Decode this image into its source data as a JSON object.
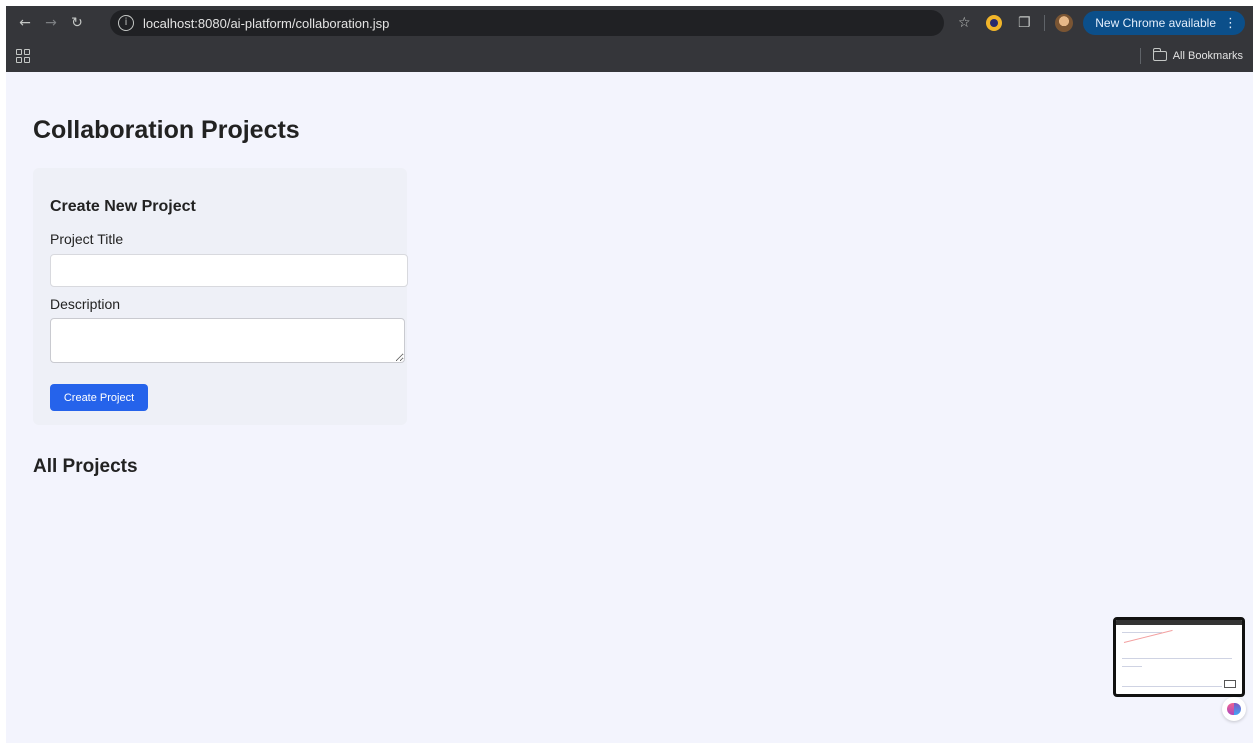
{
  "browser": {
    "url": "localhost:8080/ai-platform/collaboration.jsp",
    "update_label": "New Chrome available",
    "bookmarks_label": "All Bookmarks"
  },
  "page": {
    "title": "Collaboration Projects",
    "form": {
      "heading": "Create New Project",
      "title_label": "Project Title",
      "title_value": "",
      "description_label": "Description",
      "description_value": "",
      "submit_label": "Create Project"
    },
    "projects_heading": "All Projects"
  },
  "colors": {
    "accent": "#2563eb",
    "page_background": "#f3f4fd",
    "card_background": "#eef0f7",
    "chrome_toolbar": "#35363a",
    "update_button": "#0b4f8a"
  },
  "icons": [
    "back-icon",
    "forward-icon",
    "reload-icon",
    "site-info-icon",
    "star-icon",
    "extension-icon",
    "puzzle-icon",
    "avatar",
    "kebab-menu-icon",
    "apps-grid-icon",
    "folder-icon",
    "brain-icon"
  ]
}
